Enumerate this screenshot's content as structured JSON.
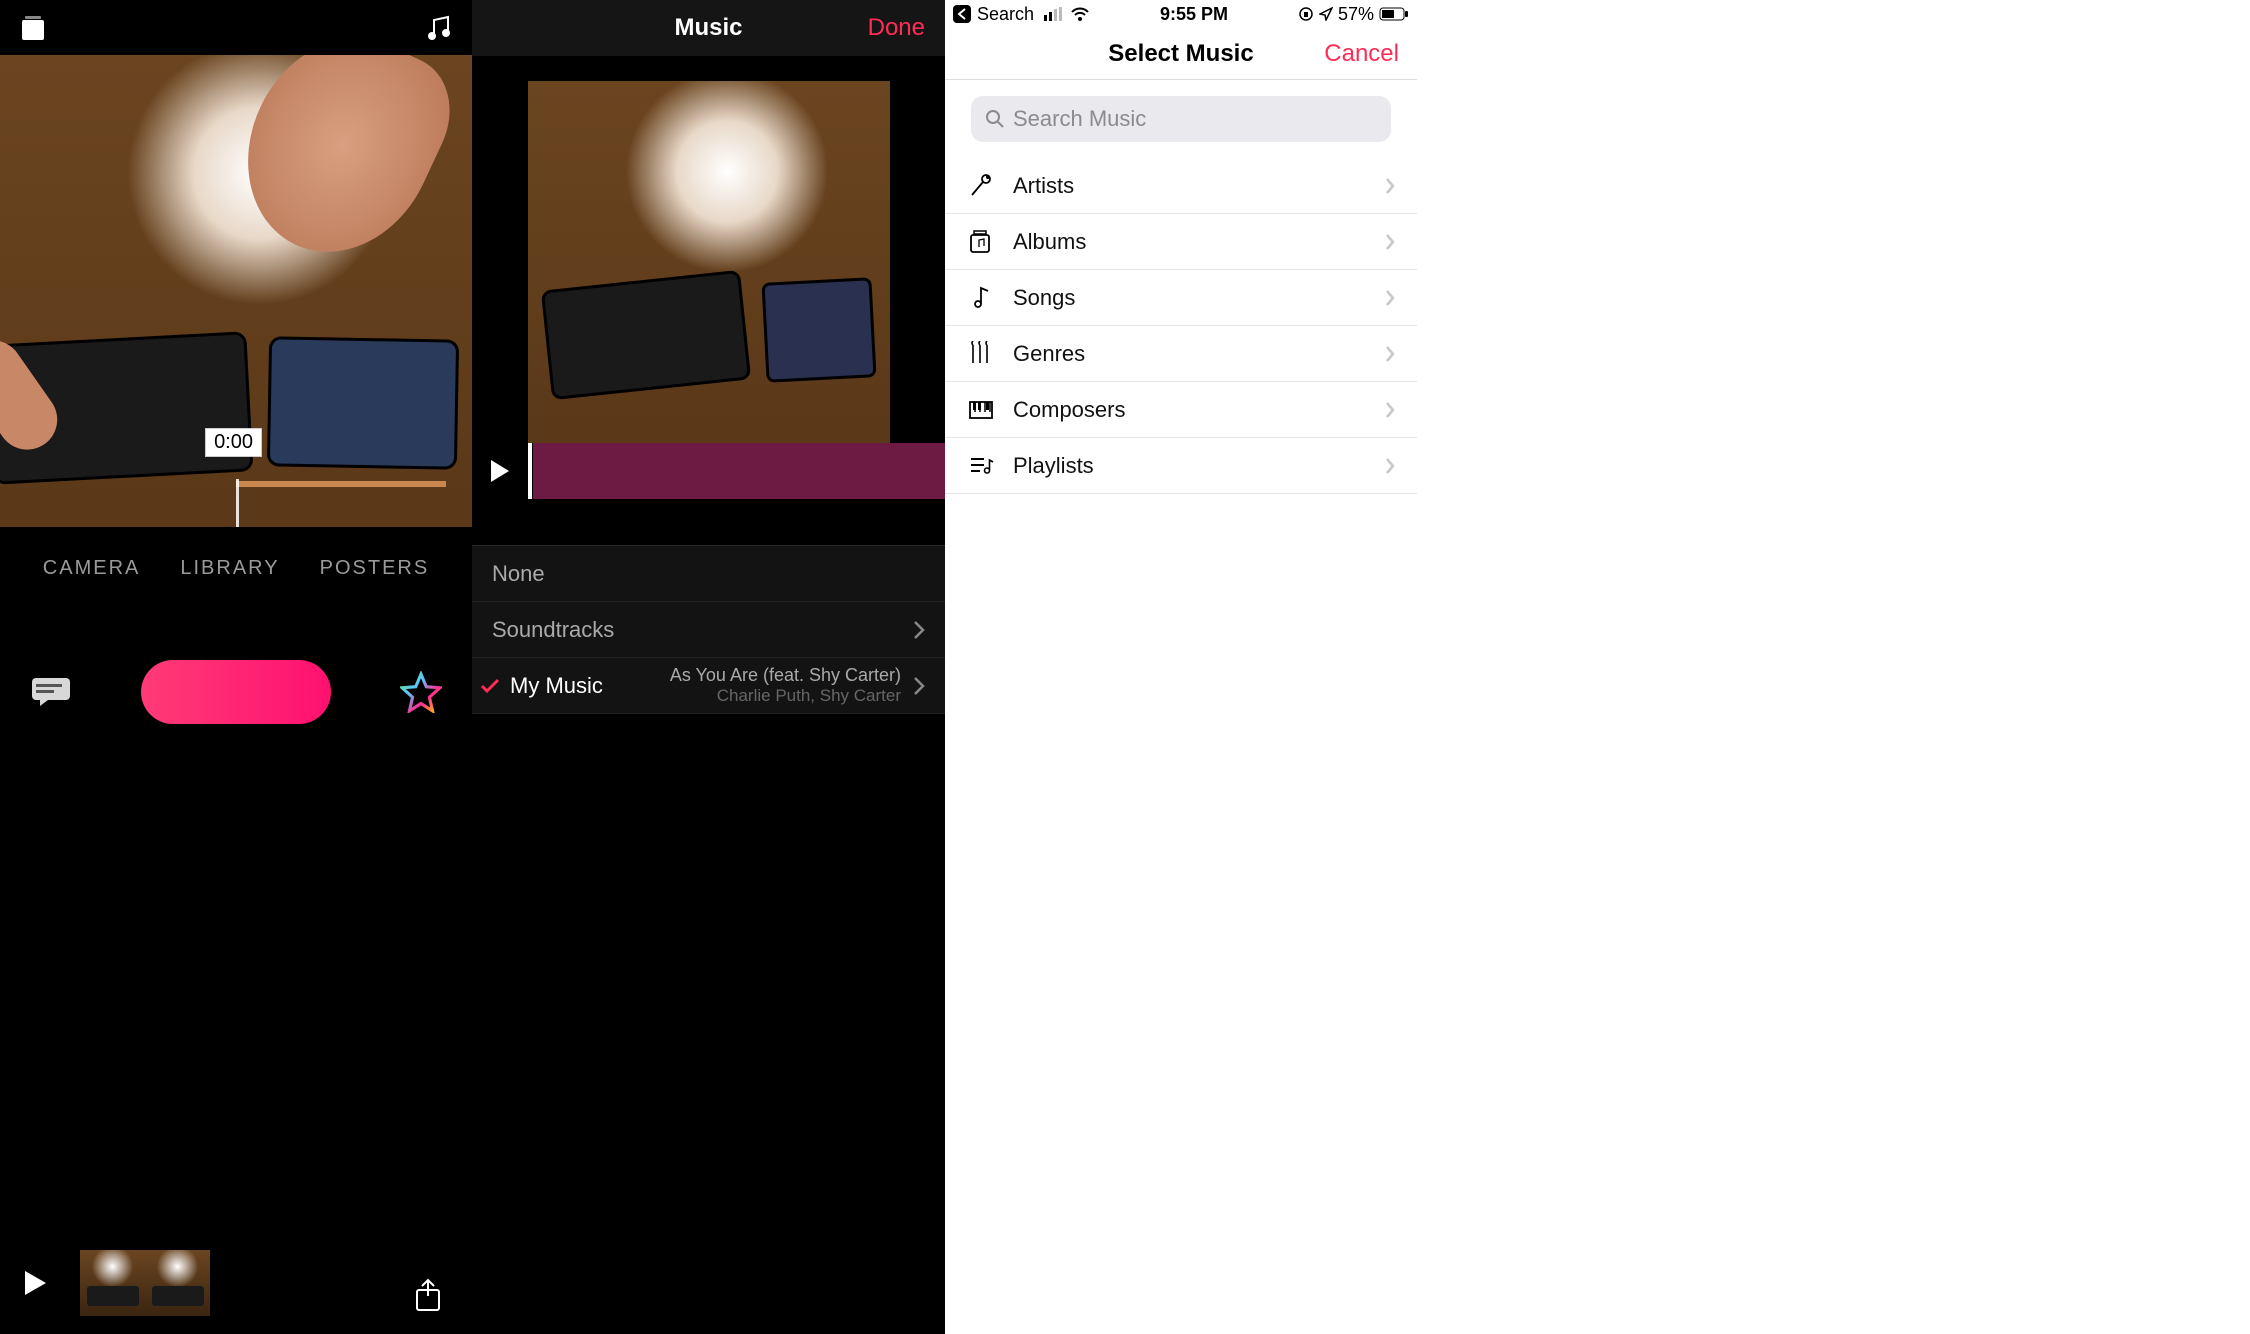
{
  "panel1": {
    "time_label": "0:00",
    "tabs": [
      "CAMERA",
      "LIBRARY",
      "POSTERS"
    ]
  },
  "panel2": {
    "title": "Music",
    "done": "Done",
    "rows": {
      "none": "None",
      "soundtracks": "Soundtracks",
      "mymusic": {
        "label": "My Music",
        "song": "As You Are (feat. Shy Carter)",
        "artist": "Charlie Puth, Shy Carter"
      }
    }
  },
  "panel3": {
    "statusbar": {
      "back_label": "Search",
      "time": "9:55 PM",
      "battery": "57%"
    },
    "title": "Select Music",
    "cancel": "Cancel",
    "search_placeholder": "Search Music",
    "items": [
      {
        "label": "Artists"
      },
      {
        "label": "Albums"
      },
      {
        "label": "Songs"
      },
      {
        "label": "Genres"
      },
      {
        "label": "Composers"
      },
      {
        "label": "Playlists"
      }
    ]
  }
}
